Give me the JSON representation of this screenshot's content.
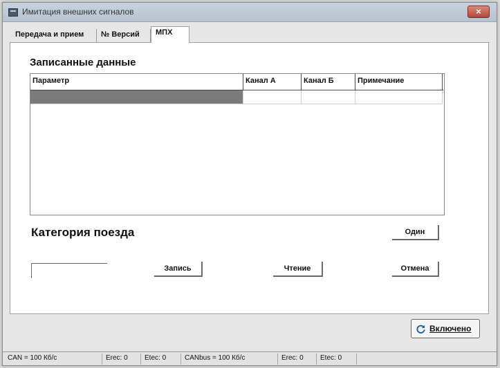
{
  "window": {
    "title": "Имитация внешних сигналов",
    "close_label": "×"
  },
  "tabs": [
    {
      "label": "Передача и прием"
    },
    {
      "label": "№ Версий"
    },
    {
      "label": "МПХ"
    }
  ],
  "recorded": {
    "title": "Записанные данные",
    "columns": [
      "Параметр",
      "Канал А",
      "Канал Б",
      "Примечание"
    ]
  },
  "category": {
    "title": "Категория поезда"
  },
  "buttons": {
    "one": "Один",
    "write": "Запись",
    "read": "Чтение",
    "cancel": "Отмена",
    "enabled": "Включено"
  },
  "status": [
    "CAN = 100 Кб/с",
    "Erec: 0",
    "Etec: 0",
    "CANbus = 100 Кб/с",
    "Erec: 0",
    "Etec: 0"
  ]
}
